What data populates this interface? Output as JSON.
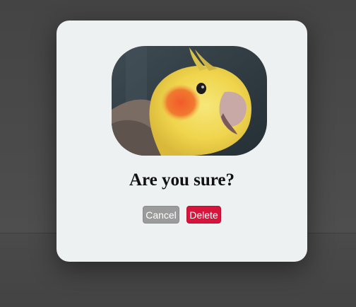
{
  "dialog": {
    "image_alt": "cockatiel-photo",
    "title": "Are you sure?",
    "cancel_label": "Cancel",
    "delete_label": "Delete"
  },
  "colors": {
    "overlay": "#4b4b4b",
    "dialog_bg": "#eef1f1",
    "cancel_bg": "#9b9b9b",
    "delete_bg": "#d6143c"
  }
}
